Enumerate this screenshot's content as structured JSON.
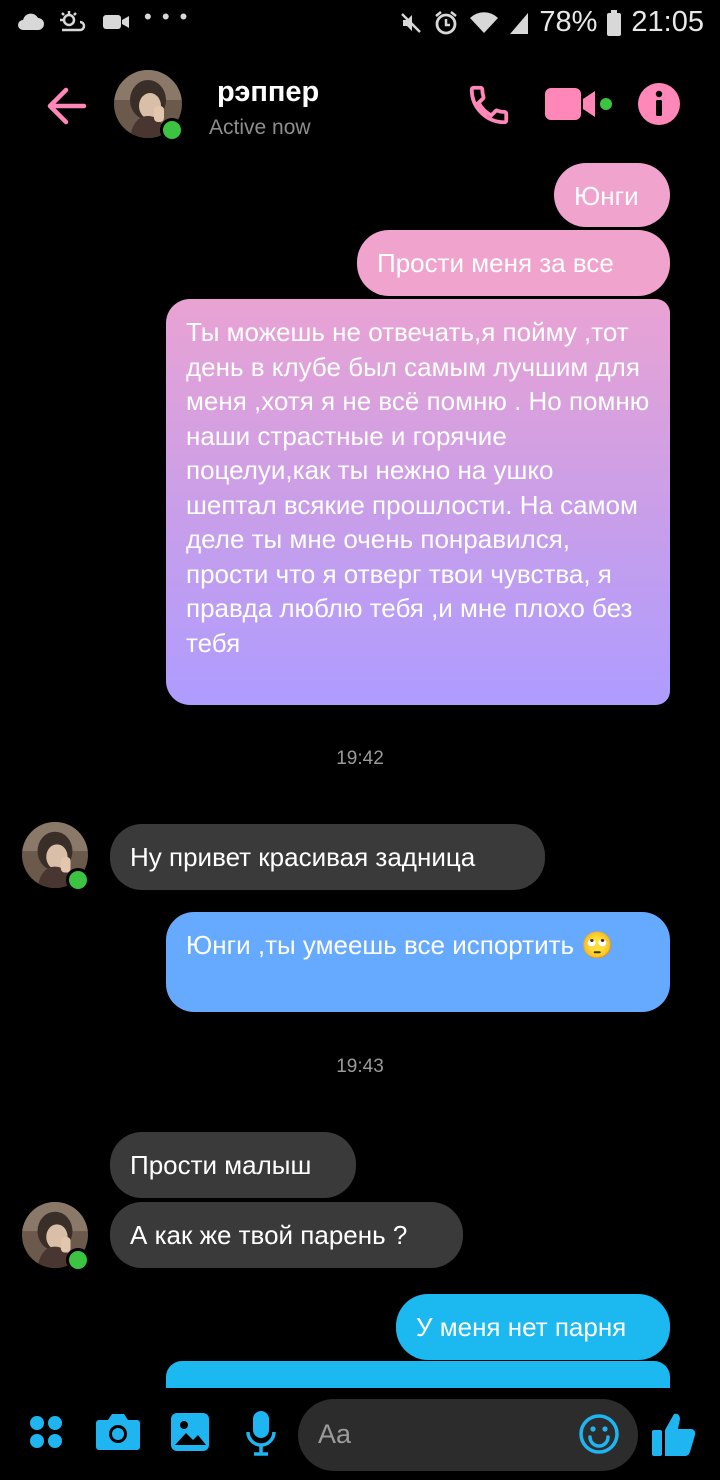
{
  "status_bar": {
    "battery_percent": "78%",
    "time": "21:05",
    "left_icons": [
      "cloud-icon",
      "weather-icon",
      "video-camera-icon",
      "more-dots-icon"
    ],
    "right_icons": [
      "mute-icon",
      "alarm-icon",
      "wifi-icon",
      "signal-icon",
      "battery-icon"
    ]
  },
  "header": {
    "contact_name": "рэппер",
    "contact_status": "Active now",
    "accent_color": "#ff88b8",
    "buttons": [
      "back-arrow-icon",
      "phone-icon",
      "video-call-icon",
      "info-icon"
    ]
  },
  "conversation": {
    "msg1": "Юнги",
    "msg2": "Прости меня за все",
    "msg3": "Ты можешь не отвечать,я пойму ,тот день в клубе был самым лучшим для меня ,хотя я не всё помню . Но помню наши страстные и горячие поцелуи,как ты нежно на ушко шептал всякие прошлости.  На самом деле ты мне очень понравился, прости что я отверг твои чувства, я правда люблю тебя ,и мне плохо без тебя",
    "time1": "19:42",
    "msg4": "Ну привет красивая задница",
    "msg5": "Юнги ,ты умеешь все испортить",
    "msg5_emoji": "🙄",
    "time2": "19:43",
    "msg6": "Прости малыш",
    "msg7": "А как же твой парень ?",
    "msg8": "У меня нет парня"
  },
  "composer": {
    "placeholder": "Aa",
    "accent_color": "#1fb5f0",
    "buttons": [
      "apps-icon",
      "camera-icon",
      "gallery-icon",
      "microphone-icon",
      "emoji-icon",
      "thumbs-up-icon"
    ]
  }
}
